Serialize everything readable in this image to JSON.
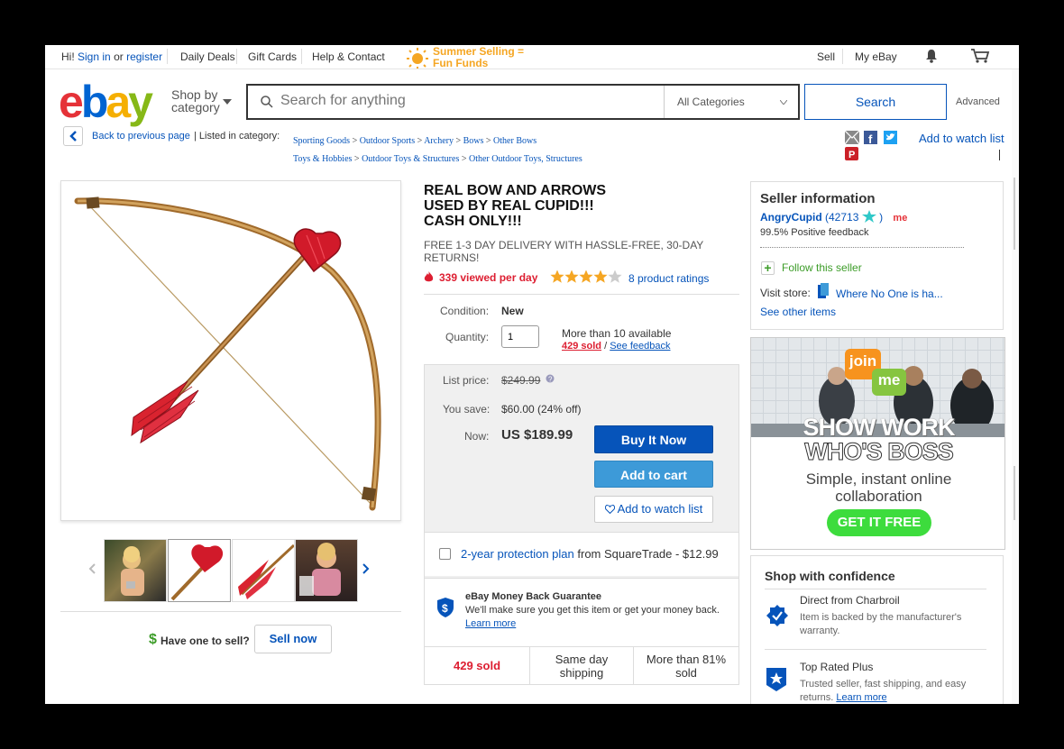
{
  "topbar": {
    "greeting": "Hi!",
    "sign_in": "Sign in",
    "or": "or",
    "register": "register",
    "daily_deals": "Daily Deals",
    "gift_cards": "Gift Cards",
    "help_contact": "Help & Contact",
    "promo_line1": "Summer Selling =",
    "promo_line2": "Fun Funds",
    "sell": "Sell",
    "my_ebay": "My eBay"
  },
  "header": {
    "logo": [
      "e",
      "b",
      "a",
      "y"
    ],
    "shop_by_line1": "Shop by",
    "shop_by_line2": "category",
    "search_placeholder": "Search for anything",
    "category_select": "All Categories",
    "search_button": "Search",
    "advanced": "Advanced"
  },
  "breadcrumb": {
    "back": "Back to previous page",
    "listed_in": "| Listed in category:",
    "path1": [
      "Sporting Goods",
      "Outdoor Sports",
      "Archery",
      "Bows",
      "Other Bows"
    ],
    "path2": [
      "Toys & Hobbies",
      "Outdoor Toys & Structures",
      "Other Outdoor Toys, Structures"
    ],
    "add_to_watch": "Add to watch list"
  },
  "gallery": {
    "have_one": "Have one to sell?",
    "sell_now": "Sell now"
  },
  "item": {
    "title_lines": [
      "REAL BOW AND ARROWS",
      "USED BY REAL CUPID!!!",
      "CASH ONLY!!!"
    ],
    "delivery_line1": "FREE 1-3 DAY DELIVERY WITH HASSLE-FREE, 30-DAY",
    "delivery_line2": "RETURNS!",
    "viewed": "339 viewed per day",
    "rating": 4,
    "rating_count": "8 product ratings",
    "condition_label": "Condition:",
    "condition_value": "New",
    "quantity_label": "Quantity:",
    "quantity_value": "1",
    "available": "More than 10 available",
    "sold": "429 sold",
    "slash": "/",
    "see_feedback": "See feedback"
  },
  "pricing": {
    "list_label": "List price:",
    "list_value": "$249.99",
    "save_label": "You save:",
    "save_value": "$60.00 (24% off)",
    "now_label": "Now:",
    "now_value": "US $189.99",
    "buy_now": "Buy It Now",
    "add_cart": "Add to cart",
    "add_watch": "Add to watch list",
    "protection_link": "2-year protection plan",
    "protection_rest": "from SquareTrade - $12.99",
    "guarantee_title": "eBay Money Back Guarantee",
    "guarantee_text": "We'll make sure you get this item or get your money back.",
    "learn_more": "Learn more",
    "stat1": "429 sold",
    "stat2_line1": "Same day",
    "stat2_line2": "shipping",
    "stat3_line1": "More than 81%",
    "stat3_line2": "sold"
  },
  "seller": {
    "heading": "Seller information",
    "name": "AngryCupid",
    "score": "(42713",
    "score_close": ")",
    "me_badge": "me",
    "feedback": "99.5% Positive feedback",
    "follow": "Follow this seller",
    "visit_label": "Visit store:",
    "store_name": "Where No One is ha...",
    "see_other": "See other items"
  },
  "ad": {
    "logo_top": "join",
    "logo_bottom": "me",
    "headline1": "SHOW WORK",
    "headline2": "WHO'S BOSS",
    "sub1": "Simple, instant online",
    "sub2": "collaboration",
    "cta": "GET IT FREE"
  },
  "confidence": {
    "heading": "Shop with confidence",
    "item1_title": "Direct from Charbroil",
    "item1_text1": "Item is backed by the manufacturer's",
    "item1_text2": "warranty.",
    "item2_title": "Top Rated Plus",
    "item2_text1": "Trusted seller, fast shipping, and easy",
    "item2_text2": "returns.",
    "item2_learn": "Learn more"
  },
  "colors": {
    "ebay_red": "#e53238",
    "ebay_blue": "#0064d2",
    "ebay_yellow": "#f5af02",
    "ebay_green": "#86b817",
    "link": "#0654ba",
    "buy_button": "#0654ba",
    "cart_button": "#3d9ad8",
    "sold_red": "#dd1e31"
  }
}
